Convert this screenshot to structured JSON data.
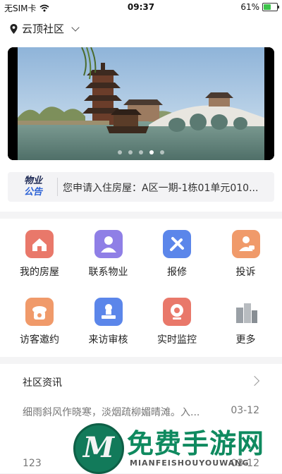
{
  "status_bar": {
    "carrier": "无SIM卡",
    "time": "09:37",
    "battery": "61%",
    "battery_level": 0.61
  },
  "location": {
    "label": "云顶社区"
  },
  "banner": {
    "dot_count": 5,
    "active_dot": 3
  },
  "notice": {
    "logo_line1": "物业",
    "logo_line2": "公告",
    "text": "您申请入住房屋：A区一期-1栋01单元010..."
  },
  "grid": [
    {
      "label": "我的房屋",
      "icon": "house-icon",
      "color": "#e9786a"
    },
    {
      "label": "联系物业",
      "icon": "person-icon",
      "color": "#8f7fe6"
    },
    {
      "label": "报修",
      "icon": "tools-icon",
      "color": "#5b86ea"
    },
    {
      "label": "投诉",
      "icon": "complaint-icon",
      "color": "#f09a6a"
    },
    {
      "label": "访客邀约",
      "icon": "phone-icon",
      "color": "#f09a6a"
    },
    {
      "label": "来访审核",
      "icon": "stamp-icon",
      "color": "#5b86ea"
    },
    {
      "label": "实时监控",
      "icon": "camera-icon",
      "color": "#e9786a"
    },
    {
      "label": "更多",
      "icon": "more-icon",
      "color": "#9aa0a6"
    }
  ],
  "news": {
    "title": "社区资讯",
    "items": [
      {
        "title": "细雨斜风作晓寒，淡烟疏柳媚晴滩。入...",
        "date": "03-12"
      },
      {
        "title": "123",
        "date": "03-12"
      }
    ]
  },
  "watermark": {
    "logo_letter": "M",
    "title": "免费手游网",
    "subtitle": "MIANFEISHOUYOUWANG"
  }
}
